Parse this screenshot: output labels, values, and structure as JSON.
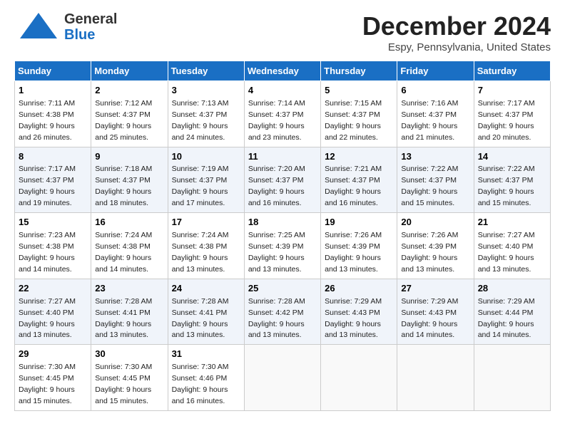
{
  "header": {
    "logo_general": "General",
    "logo_blue": "Blue",
    "month_title": "December 2024",
    "location": "Espy, Pennsylvania, United States"
  },
  "weekdays": [
    "Sunday",
    "Monday",
    "Tuesday",
    "Wednesday",
    "Thursday",
    "Friday",
    "Saturday"
  ],
  "weeks": [
    [
      {
        "day": "1",
        "sunrise": "Sunrise: 7:11 AM",
        "sunset": "Sunset: 4:38 PM",
        "daylight": "Daylight: 9 hours and 26 minutes."
      },
      {
        "day": "2",
        "sunrise": "Sunrise: 7:12 AM",
        "sunset": "Sunset: 4:37 PM",
        "daylight": "Daylight: 9 hours and 25 minutes."
      },
      {
        "day": "3",
        "sunrise": "Sunrise: 7:13 AM",
        "sunset": "Sunset: 4:37 PM",
        "daylight": "Daylight: 9 hours and 24 minutes."
      },
      {
        "day": "4",
        "sunrise": "Sunrise: 7:14 AM",
        "sunset": "Sunset: 4:37 PM",
        "daylight": "Daylight: 9 hours and 23 minutes."
      },
      {
        "day": "5",
        "sunrise": "Sunrise: 7:15 AM",
        "sunset": "Sunset: 4:37 PM",
        "daylight": "Daylight: 9 hours and 22 minutes."
      },
      {
        "day": "6",
        "sunrise": "Sunrise: 7:16 AM",
        "sunset": "Sunset: 4:37 PM",
        "daylight": "Daylight: 9 hours and 21 minutes."
      },
      {
        "day": "7",
        "sunrise": "Sunrise: 7:17 AM",
        "sunset": "Sunset: 4:37 PM",
        "daylight": "Daylight: 9 hours and 20 minutes."
      }
    ],
    [
      {
        "day": "8",
        "sunrise": "Sunrise: 7:17 AM",
        "sunset": "Sunset: 4:37 PM",
        "daylight": "Daylight: 9 hours and 19 minutes."
      },
      {
        "day": "9",
        "sunrise": "Sunrise: 7:18 AM",
        "sunset": "Sunset: 4:37 PM",
        "daylight": "Daylight: 9 hours and 18 minutes."
      },
      {
        "day": "10",
        "sunrise": "Sunrise: 7:19 AM",
        "sunset": "Sunset: 4:37 PM",
        "daylight": "Daylight: 9 hours and 17 minutes."
      },
      {
        "day": "11",
        "sunrise": "Sunrise: 7:20 AM",
        "sunset": "Sunset: 4:37 PM",
        "daylight": "Daylight: 9 hours and 16 minutes."
      },
      {
        "day": "12",
        "sunrise": "Sunrise: 7:21 AM",
        "sunset": "Sunset: 4:37 PM",
        "daylight": "Daylight: 9 hours and 16 minutes."
      },
      {
        "day": "13",
        "sunrise": "Sunrise: 7:22 AM",
        "sunset": "Sunset: 4:37 PM",
        "daylight": "Daylight: 9 hours and 15 minutes."
      },
      {
        "day": "14",
        "sunrise": "Sunrise: 7:22 AM",
        "sunset": "Sunset: 4:37 PM",
        "daylight": "Daylight: 9 hours and 15 minutes."
      }
    ],
    [
      {
        "day": "15",
        "sunrise": "Sunrise: 7:23 AM",
        "sunset": "Sunset: 4:38 PM",
        "daylight": "Daylight: 9 hours and 14 minutes."
      },
      {
        "day": "16",
        "sunrise": "Sunrise: 7:24 AM",
        "sunset": "Sunset: 4:38 PM",
        "daylight": "Daylight: 9 hours and 14 minutes."
      },
      {
        "day": "17",
        "sunrise": "Sunrise: 7:24 AM",
        "sunset": "Sunset: 4:38 PM",
        "daylight": "Daylight: 9 hours and 13 minutes."
      },
      {
        "day": "18",
        "sunrise": "Sunrise: 7:25 AM",
        "sunset": "Sunset: 4:39 PM",
        "daylight": "Daylight: 9 hours and 13 minutes."
      },
      {
        "day": "19",
        "sunrise": "Sunrise: 7:26 AM",
        "sunset": "Sunset: 4:39 PM",
        "daylight": "Daylight: 9 hours and 13 minutes."
      },
      {
        "day": "20",
        "sunrise": "Sunrise: 7:26 AM",
        "sunset": "Sunset: 4:39 PM",
        "daylight": "Daylight: 9 hours and 13 minutes."
      },
      {
        "day": "21",
        "sunrise": "Sunrise: 7:27 AM",
        "sunset": "Sunset: 4:40 PM",
        "daylight": "Daylight: 9 hours and 13 minutes."
      }
    ],
    [
      {
        "day": "22",
        "sunrise": "Sunrise: 7:27 AM",
        "sunset": "Sunset: 4:40 PM",
        "daylight": "Daylight: 9 hours and 13 minutes."
      },
      {
        "day": "23",
        "sunrise": "Sunrise: 7:28 AM",
        "sunset": "Sunset: 4:41 PM",
        "daylight": "Daylight: 9 hours and 13 minutes."
      },
      {
        "day": "24",
        "sunrise": "Sunrise: 7:28 AM",
        "sunset": "Sunset: 4:41 PM",
        "daylight": "Daylight: 9 hours and 13 minutes."
      },
      {
        "day": "25",
        "sunrise": "Sunrise: 7:28 AM",
        "sunset": "Sunset: 4:42 PM",
        "daylight": "Daylight: 9 hours and 13 minutes."
      },
      {
        "day": "26",
        "sunrise": "Sunrise: 7:29 AM",
        "sunset": "Sunset: 4:43 PM",
        "daylight": "Daylight: 9 hours and 13 minutes."
      },
      {
        "day": "27",
        "sunrise": "Sunrise: 7:29 AM",
        "sunset": "Sunset: 4:43 PM",
        "daylight": "Daylight: 9 hours and 14 minutes."
      },
      {
        "day": "28",
        "sunrise": "Sunrise: 7:29 AM",
        "sunset": "Sunset: 4:44 PM",
        "daylight": "Daylight: 9 hours and 14 minutes."
      }
    ],
    [
      {
        "day": "29",
        "sunrise": "Sunrise: 7:30 AM",
        "sunset": "Sunset: 4:45 PM",
        "daylight": "Daylight: 9 hours and 15 minutes."
      },
      {
        "day": "30",
        "sunrise": "Sunrise: 7:30 AM",
        "sunset": "Sunset: 4:45 PM",
        "daylight": "Daylight: 9 hours and 15 minutes."
      },
      {
        "day": "31",
        "sunrise": "Sunrise: 7:30 AM",
        "sunset": "Sunset: 4:46 PM",
        "daylight": "Daylight: 9 hours and 16 minutes."
      },
      null,
      null,
      null,
      null
    ]
  ]
}
